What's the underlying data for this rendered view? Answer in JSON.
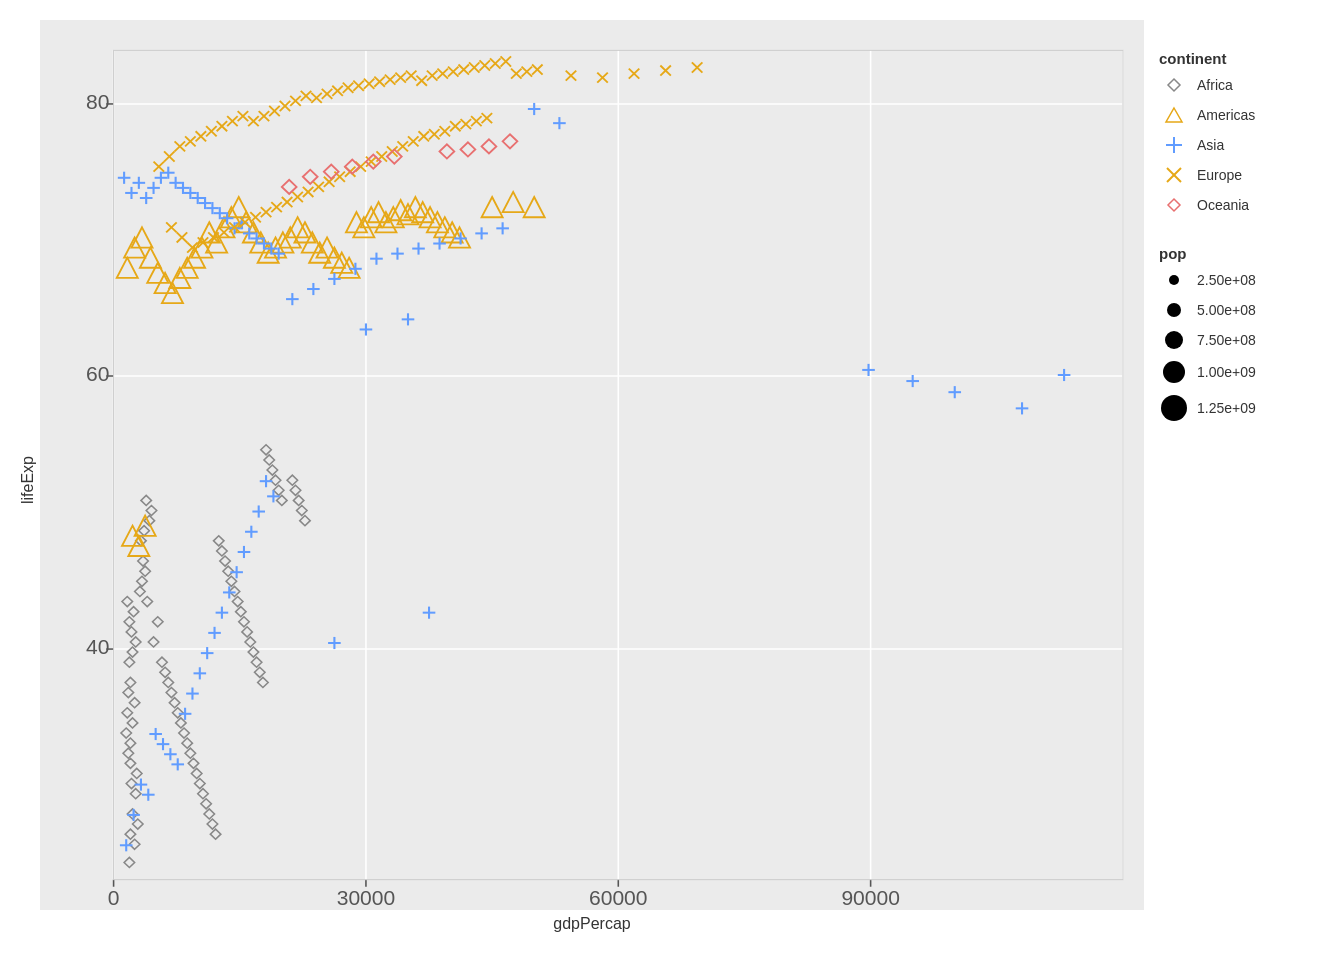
{
  "chart": {
    "title": "",
    "x_label": "gdpPercap",
    "y_label": "lifeExp",
    "background": "#ebebeb",
    "grid_color": "#ffffff",
    "x_min": 0,
    "x_max": 120000,
    "y_min": 23,
    "y_max": 84,
    "x_ticks": [
      0,
      30000,
      60000,
      90000
    ],
    "y_ticks": [
      40,
      60,
      80
    ]
  },
  "legend": {
    "continent_title": "continent",
    "pop_title": "pop",
    "continents": [
      {
        "name": "Africa",
        "shape": "diamond",
        "color": "#888888"
      },
      {
        "name": "Americas",
        "shape": "triangle",
        "color": "#E6A817"
      },
      {
        "name": "Asia",
        "shape": "plus",
        "color": "#619CFF"
      },
      {
        "name": "Europe",
        "shape": "cross",
        "color": "#E6A817"
      },
      {
        "name": "Oceania",
        "shape": "diamond-open",
        "color": "#E87070"
      }
    ],
    "pop_sizes": [
      {
        "label": "2.50e+08",
        "size": 8
      },
      {
        "label": "5.00e+08",
        "size": 12
      },
      {
        "label": "7.50e+08",
        "size": 16
      },
      {
        "label": "1.00e+09",
        "size": 20
      },
      {
        "label": "1.25e+09",
        "size": 24
      }
    ]
  }
}
